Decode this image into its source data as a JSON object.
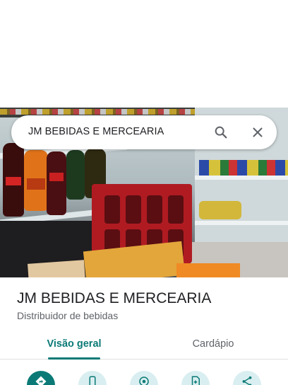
{
  "search": {
    "query": "JM BEBIDAS E MERCEARIA",
    "search_icon": "search-icon",
    "close_icon": "close-icon"
  },
  "place": {
    "title": "JM BEBIDAS E MERCEARIA",
    "category": "Distribuidor de bebidas",
    "photo": "store-interior-photo"
  },
  "tabs": [
    {
      "label": "Visão geral",
      "selected": true
    },
    {
      "label": "Cardápio",
      "selected": false
    }
  ],
  "actions": [
    {
      "icon": "directions-icon",
      "primary": true
    },
    {
      "icon": "phone-icon",
      "primary": false
    },
    {
      "icon": "location-icon",
      "primary": false
    },
    {
      "icon": "save-icon",
      "primary": false
    },
    {
      "icon": "share-icon",
      "primary": false
    }
  ],
  "colors": {
    "accent": "#0b7a76",
    "action_bg": "#d9eef0",
    "text_primary": "#202124",
    "text_secondary": "#5f6368"
  }
}
